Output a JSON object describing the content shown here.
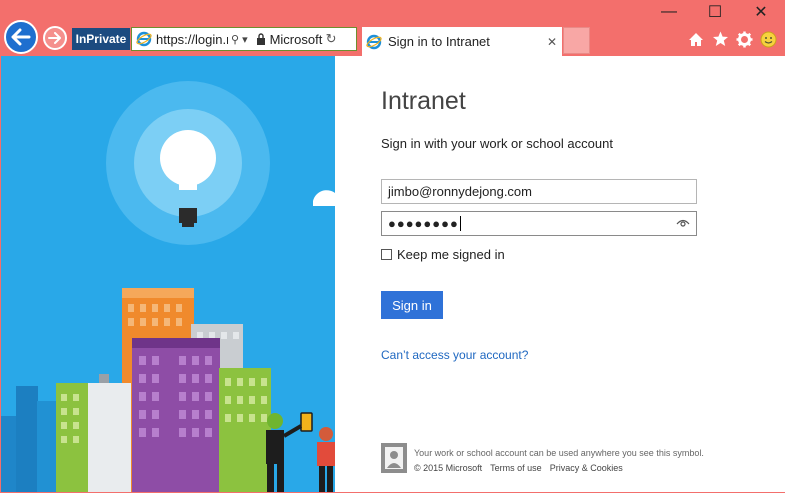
{
  "browser": {
    "inprivate_label": "InPrivate",
    "address": {
      "url": "https://login.microsoftonline.com",
      "site_name": "Microsoft"
    },
    "tab": {
      "title": "Sign in to Intranet",
      "close_glyph": "✕"
    },
    "window_controls": {
      "minimize": "—",
      "maximize": "☐",
      "close": "✕"
    },
    "toolbar": {
      "home": "home-icon",
      "favorites": "star-icon",
      "settings": "gear-icon",
      "feedback": "smiley-icon"
    },
    "colors": {
      "chrome": "#f36f6c",
      "inprivate_bg": "#1c4b80",
      "back_button": "#1e6fcf"
    }
  },
  "signin": {
    "app_name": "Intranet",
    "subtitle": "Sign in with your work or school account",
    "username": {
      "value": "jimbo@ronnydejong.com"
    },
    "password": {
      "masked_value": "●●●●●●●●"
    },
    "keep_signed_in": {
      "label": "Keep me signed in",
      "checked": false
    },
    "submit_label": "Sign in",
    "cant_access_link": "Can’t access your account?",
    "colors": {
      "button": "#2f72d8",
      "link": "#1f68c1",
      "illustration_bg": "#29a8e8"
    }
  },
  "footer": {
    "note": "Your work or school account can be used anywhere you see this symbol.",
    "copyright": "© 2015 Microsoft",
    "terms": "Terms of use",
    "privacy": "Privacy & Cookies"
  }
}
